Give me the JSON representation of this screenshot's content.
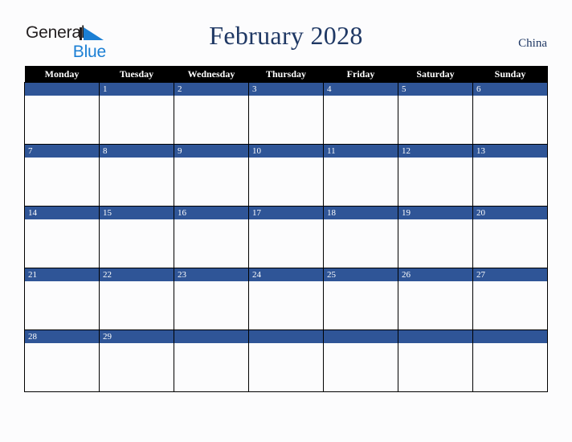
{
  "brand": {
    "name_part1": "General",
    "name_part2": "Blue",
    "triangle_icon": "blue-triangle-icon",
    "accent_dark": "#231f20",
    "accent_blue": "#1b7fd4"
  },
  "header": {
    "title": "February 2028",
    "country": "China",
    "title_color": "#1f3864"
  },
  "calendar": {
    "month": "February",
    "year": "2028",
    "first_day_of_week": "Monday",
    "header_bg": "#000000",
    "daynum_bg": "#2f5597",
    "cell_bg": "#fcfcfd",
    "weekdays": [
      "Monday",
      "Tuesday",
      "Wednesday",
      "Thursday",
      "Friday",
      "Saturday",
      "Sunday"
    ],
    "weeks": [
      [
        "",
        "1",
        "2",
        "3",
        "4",
        "5",
        "6"
      ],
      [
        "7",
        "8",
        "9",
        "10",
        "11",
        "12",
        "13"
      ],
      [
        "14",
        "15",
        "16",
        "17",
        "18",
        "19",
        "20"
      ],
      [
        "21",
        "22",
        "23",
        "24",
        "25",
        "26",
        "27"
      ],
      [
        "28",
        "29",
        "",
        "",
        "",
        "",
        ""
      ]
    ]
  }
}
